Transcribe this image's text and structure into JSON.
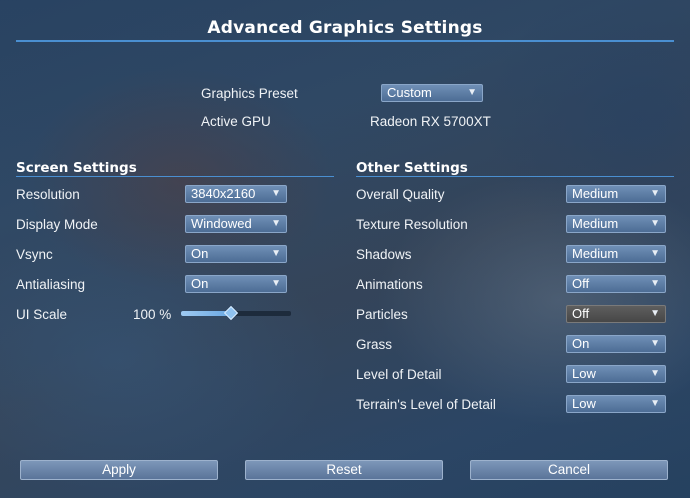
{
  "title": "Advanced Graphics Settings",
  "preset": {
    "label": "Graphics Preset",
    "value": "Custom"
  },
  "gpu": {
    "label": "Active GPU",
    "value": "Radeon RX 5700XT"
  },
  "screen": {
    "title": "Screen Settings",
    "resolution": {
      "label": "Resolution",
      "value": "3840x2160"
    },
    "display_mode": {
      "label": "Display Mode",
      "value": "Windowed"
    },
    "vsync": {
      "label": "Vsync",
      "value": "On"
    },
    "antialiasing": {
      "label": "Antialiasing",
      "value": "On"
    },
    "ui_scale": {
      "label": "UI Scale",
      "value_text": "100 %",
      "slider_fraction": 0.45
    }
  },
  "other": {
    "title": "Other Settings",
    "items": [
      {
        "label": "Overall Quality",
        "value": "Medium"
      },
      {
        "label": "Texture Resolution",
        "value": "Medium"
      },
      {
        "label": "Shadows",
        "value": "Medium"
      },
      {
        "label": "Animations",
        "value": "Off"
      },
      {
        "label": "Particles",
        "value": "Off"
      },
      {
        "label": "Grass",
        "value": "On"
      },
      {
        "label": "Level of Detail",
        "value": "Low"
      },
      {
        "label": "Terrain's Level of Detail",
        "value": "Low"
      }
    ]
  },
  "buttons": {
    "apply": "Apply",
    "reset": "Reset",
    "cancel": "Cancel"
  },
  "icons": {
    "dropdown": "chevron-down-icon"
  },
  "colors": {
    "accent": "#4a8fd1",
    "dropdown": "#5f7fa7",
    "button": "#6b85a9"
  }
}
